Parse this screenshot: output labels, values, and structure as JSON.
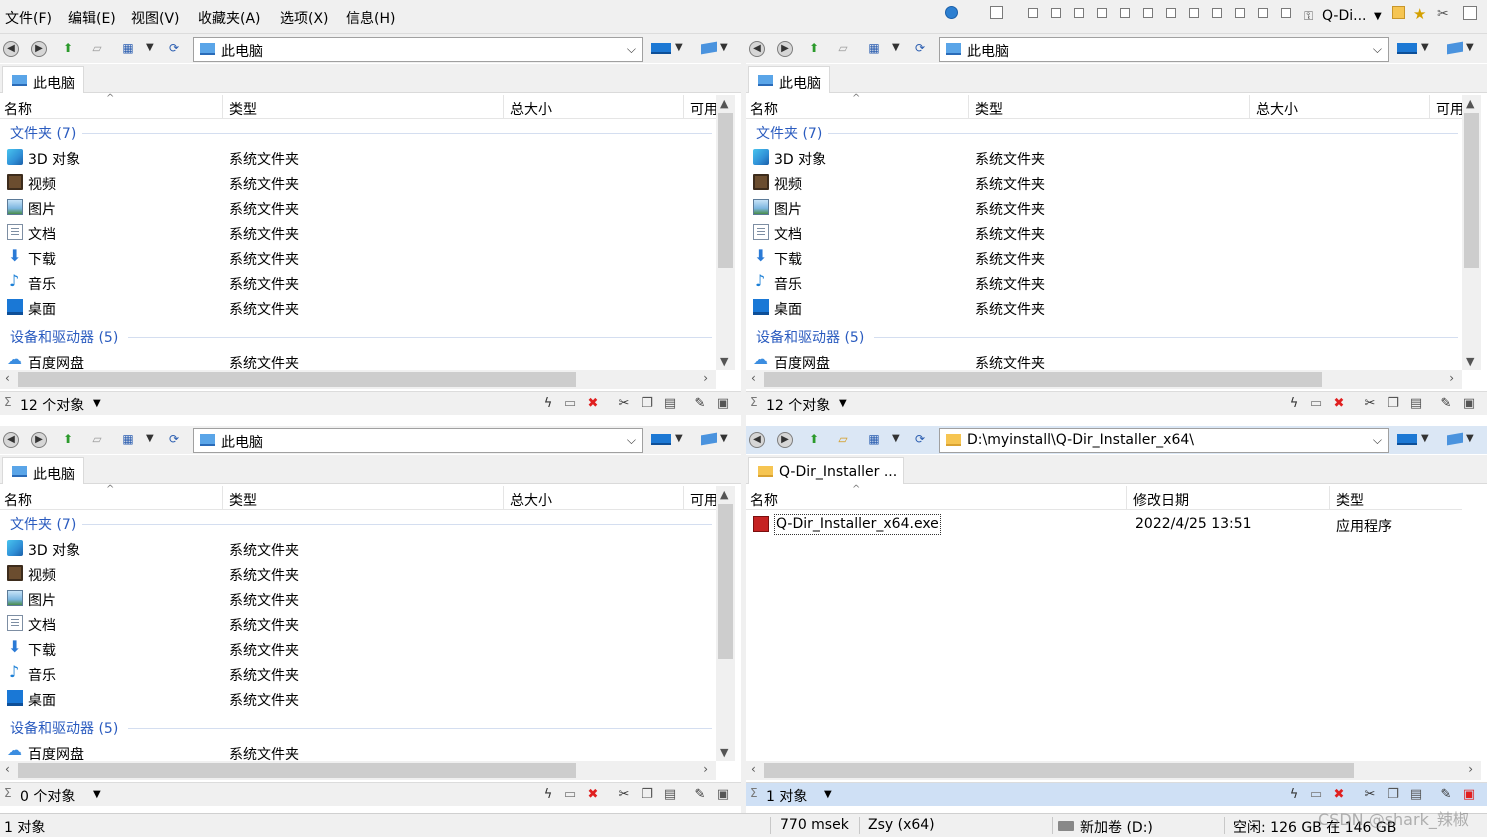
{
  "menu": {
    "file": "文件(F)",
    "edit": "编辑(E)",
    "view": "视图(V)",
    "favorites": "收藏夹(A)",
    "options": "选项(X)",
    "info": "信息(H)",
    "app_name": "Q-Di..."
  },
  "panes": [
    {
      "address": "此电脑",
      "tab": "此电脑",
      "columns": [
        "名称",
        "类型",
        "总大小",
        "可用"
      ],
      "group_folders": "文件夹 (7)",
      "group_devices": "设备和驱动器 (5)",
      "rows": [
        {
          "name": "3D 对象",
          "type": "系统文件夹",
          "icon": "3d-objects-icon"
        },
        {
          "name": "视频",
          "type": "系统文件夹",
          "icon": "video-icon"
        },
        {
          "name": "图片",
          "type": "系统文件夹",
          "icon": "picture-icon"
        },
        {
          "name": "文档",
          "type": "系统文件夹",
          "icon": "document-icon"
        },
        {
          "name": "下载",
          "type": "系统文件夹",
          "icon": "download-icon"
        },
        {
          "name": "音乐",
          "type": "系统文件夹",
          "icon": "music-icon"
        },
        {
          "name": "桌面",
          "type": "系统文件夹",
          "icon": "desktop-icon"
        }
      ],
      "device_rows": [
        {
          "name": "百度网盘",
          "type": "系统文件夹",
          "icon": "baidu-netdisk-icon"
        }
      ],
      "status": "12 个对象"
    },
    {
      "address": "此电脑",
      "tab": "此电脑",
      "columns": [
        "名称",
        "类型",
        "总大小",
        "可用"
      ],
      "group_folders": "文件夹 (7)",
      "group_devices": "设备和驱动器 (5)",
      "rows": [
        {
          "name": "3D 对象",
          "type": "系统文件夹",
          "icon": "3d-objects-icon"
        },
        {
          "name": "视频",
          "type": "系统文件夹",
          "icon": "video-icon"
        },
        {
          "name": "图片",
          "type": "系统文件夹",
          "icon": "picture-icon"
        },
        {
          "name": "文档",
          "type": "系统文件夹",
          "icon": "document-icon"
        },
        {
          "name": "下载",
          "type": "系统文件夹",
          "icon": "download-icon"
        },
        {
          "name": "音乐",
          "type": "系统文件夹",
          "icon": "music-icon"
        },
        {
          "name": "桌面",
          "type": "系统文件夹",
          "icon": "desktop-icon"
        }
      ],
      "device_rows": [
        {
          "name": "百度网盘",
          "type": "系统文件夹",
          "icon": "baidu-netdisk-icon"
        }
      ],
      "status": "12 个对象"
    },
    {
      "address": "此电脑",
      "tab": "此电脑",
      "columns": [
        "名称",
        "类型",
        "总大小",
        "可用"
      ],
      "group_folders": "文件夹 (7)",
      "group_devices": "设备和驱动器 (5)",
      "rows": [
        {
          "name": "3D 对象",
          "type": "系统文件夹",
          "icon": "3d-objects-icon"
        },
        {
          "name": "视频",
          "type": "系统文件夹",
          "icon": "video-icon"
        },
        {
          "name": "图片",
          "type": "系统文件夹",
          "icon": "picture-icon"
        },
        {
          "name": "文档",
          "type": "系统文件夹",
          "icon": "document-icon"
        },
        {
          "name": "下载",
          "type": "系统文件夹",
          "icon": "download-icon"
        },
        {
          "name": "音乐",
          "type": "系统文件夹",
          "icon": "music-icon"
        },
        {
          "name": "桌面",
          "type": "系统文件夹",
          "icon": "desktop-icon"
        }
      ],
      "device_rows": [
        {
          "name": "百度网盘",
          "type": "系统文件夹",
          "icon": "baidu-netdisk-icon"
        }
      ],
      "status": "0 个对象"
    },
    {
      "address": "D:\\myinstall\\Q-Dir_Installer_x64\\",
      "tab": "Q-Dir_Installer ...",
      "columns": [
        "名称",
        "修改日期",
        "类型"
      ],
      "rows": [
        {
          "name": "Q-Dir_Installer_x64.exe",
          "date": "2022/4/25 13:51",
          "type": "应用程序",
          "icon": "exe-icon"
        }
      ],
      "status": "1 对象"
    }
  ],
  "global_status": {
    "objects": "1 对象",
    "timing": "770 msek",
    "user": "Zsy (x64)",
    "drive": "新加卷 (D:)",
    "free": "空闲: 126 GB 在 146 GB"
  },
  "watermark": "CSDN @shark_辣椒",
  "colors": {
    "group_text": "#2a5bbf",
    "active_pane": "#cfe0f5",
    "delete_red": "#e02020"
  }
}
